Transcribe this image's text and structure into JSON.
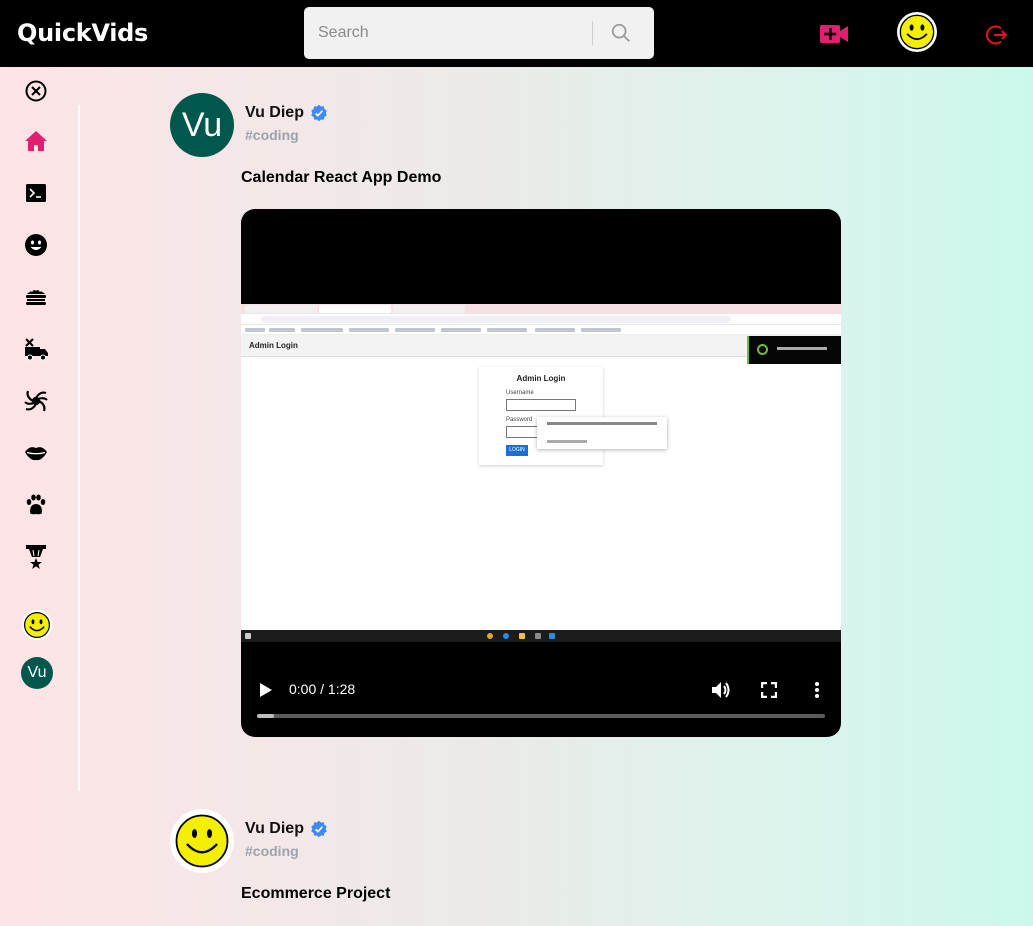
{
  "app": {
    "brand": "QuickVids"
  },
  "search": {
    "placeholder": "Search"
  },
  "posts": [
    {
      "author": "Vu Diep",
      "avatar_initials": "Vu",
      "topic": "#coding",
      "caption": "Calendar React App Demo",
      "video": {
        "current_time": "0:00",
        "duration": "1:28",
        "time_display": "0:00 / 1:28",
        "progress": 0.03,
        "screen": {
          "page_title": "Admin Login",
          "card_title": "Admin Login",
          "username_label": "Username",
          "password_label": "Password",
          "login_button": "LOGIN"
        }
      }
    },
    {
      "author": "Vu Diep",
      "avatar_icon": "smiley-face-icon",
      "topic": "#coding",
      "caption": "Ecommerce Project"
    }
  ],
  "sidebar": {
    "items": [
      {
        "icon": "close-circle-icon"
      },
      {
        "icon": "home-icon"
      },
      {
        "icon": "terminal-icon"
      },
      {
        "icon": "smiley-icon"
      },
      {
        "icon": "food-icon"
      },
      {
        "icon": "food-truck-icon"
      },
      {
        "icon": "spiral-icon"
      },
      {
        "icon": "lips-icon"
      },
      {
        "icon": "paw-icon"
      },
      {
        "icon": "medal-icon"
      }
    ],
    "accounts": [
      {
        "icon": "smiley-face-icon"
      },
      {
        "initials": "Vu"
      }
    ]
  },
  "colors": {
    "accent": "#e0206f",
    "logout": "#e4141a",
    "verified": "#3d8af7",
    "avatar_green": "#00574b",
    "topic_gray": "#9aa3b0"
  }
}
